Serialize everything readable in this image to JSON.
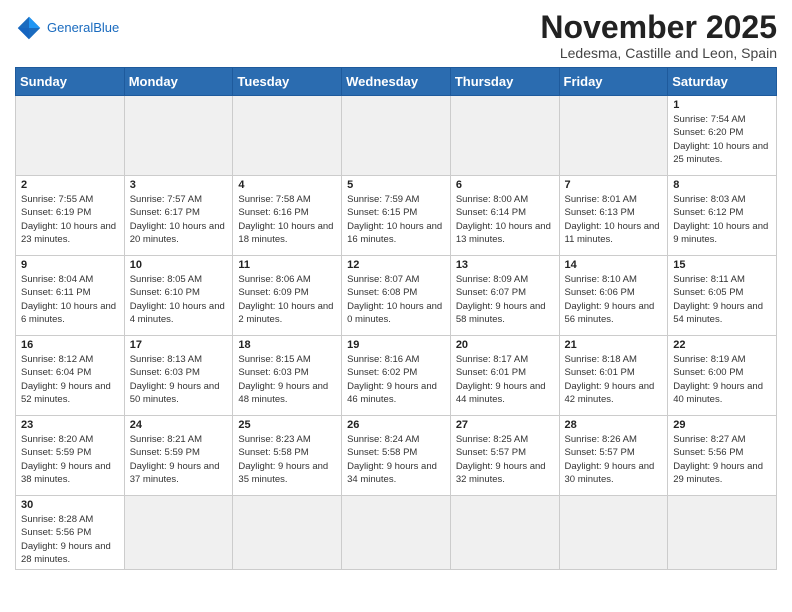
{
  "header": {
    "logo_general": "General",
    "logo_blue": "Blue",
    "month_title": "November 2025",
    "location": "Ledesma, Castille and Leon, Spain"
  },
  "weekdays": [
    "Sunday",
    "Monday",
    "Tuesday",
    "Wednesday",
    "Thursday",
    "Friday",
    "Saturday"
  ],
  "weeks": [
    [
      {
        "day": "",
        "info": ""
      },
      {
        "day": "",
        "info": ""
      },
      {
        "day": "",
        "info": ""
      },
      {
        "day": "",
        "info": ""
      },
      {
        "day": "",
        "info": ""
      },
      {
        "day": "",
        "info": ""
      },
      {
        "day": "1",
        "info": "Sunrise: 7:54 AM\nSunset: 6:20 PM\nDaylight: 10 hours and 25 minutes."
      }
    ],
    [
      {
        "day": "2",
        "info": "Sunrise: 7:55 AM\nSunset: 6:19 PM\nDaylight: 10 hours and 23 minutes."
      },
      {
        "day": "3",
        "info": "Sunrise: 7:57 AM\nSunset: 6:17 PM\nDaylight: 10 hours and 20 minutes."
      },
      {
        "day": "4",
        "info": "Sunrise: 7:58 AM\nSunset: 6:16 PM\nDaylight: 10 hours and 18 minutes."
      },
      {
        "day": "5",
        "info": "Sunrise: 7:59 AM\nSunset: 6:15 PM\nDaylight: 10 hours and 16 minutes."
      },
      {
        "day": "6",
        "info": "Sunrise: 8:00 AM\nSunset: 6:14 PM\nDaylight: 10 hours and 13 minutes."
      },
      {
        "day": "7",
        "info": "Sunrise: 8:01 AM\nSunset: 6:13 PM\nDaylight: 10 hours and 11 minutes."
      },
      {
        "day": "8",
        "info": "Sunrise: 8:03 AM\nSunset: 6:12 PM\nDaylight: 10 hours and 9 minutes."
      }
    ],
    [
      {
        "day": "9",
        "info": "Sunrise: 8:04 AM\nSunset: 6:11 PM\nDaylight: 10 hours and 6 minutes."
      },
      {
        "day": "10",
        "info": "Sunrise: 8:05 AM\nSunset: 6:10 PM\nDaylight: 10 hours and 4 minutes."
      },
      {
        "day": "11",
        "info": "Sunrise: 8:06 AM\nSunset: 6:09 PM\nDaylight: 10 hours and 2 minutes."
      },
      {
        "day": "12",
        "info": "Sunrise: 8:07 AM\nSunset: 6:08 PM\nDaylight: 10 hours and 0 minutes."
      },
      {
        "day": "13",
        "info": "Sunrise: 8:09 AM\nSunset: 6:07 PM\nDaylight: 9 hours and 58 minutes."
      },
      {
        "day": "14",
        "info": "Sunrise: 8:10 AM\nSunset: 6:06 PM\nDaylight: 9 hours and 56 minutes."
      },
      {
        "day": "15",
        "info": "Sunrise: 8:11 AM\nSunset: 6:05 PM\nDaylight: 9 hours and 54 minutes."
      }
    ],
    [
      {
        "day": "16",
        "info": "Sunrise: 8:12 AM\nSunset: 6:04 PM\nDaylight: 9 hours and 52 minutes."
      },
      {
        "day": "17",
        "info": "Sunrise: 8:13 AM\nSunset: 6:03 PM\nDaylight: 9 hours and 50 minutes."
      },
      {
        "day": "18",
        "info": "Sunrise: 8:15 AM\nSunset: 6:03 PM\nDaylight: 9 hours and 48 minutes."
      },
      {
        "day": "19",
        "info": "Sunrise: 8:16 AM\nSunset: 6:02 PM\nDaylight: 9 hours and 46 minutes."
      },
      {
        "day": "20",
        "info": "Sunrise: 8:17 AM\nSunset: 6:01 PM\nDaylight: 9 hours and 44 minutes."
      },
      {
        "day": "21",
        "info": "Sunrise: 8:18 AM\nSunset: 6:01 PM\nDaylight: 9 hours and 42 minutes."
      },
      {
        "day": "22",
        "info": "Sunrise: 8:19 AM\nSunset: 6:00 PM\nDaylight: 9 hours and 40 minutes."
      }
    ],
    [
      {
        "day": "23",
        "info": "Sunrise: 8:20 AM\nSunset: 5:59 PM\nDaylight: 9 hours and 38 minutes."
      },
      {
        "day": "24",
        "info": "Sunrise: 8:21 AM\nSunset: 5:59 PM\nDaylight: 9 hours and 37 minutes."
      },
      {
        "day": "25",
        "info": "Sunrise: 8:23 AM\nSunset: 5:58 PM\nDaylight: 9 hours and 35 minutes."
      },
      {
        "day": "26",
        "info": "Sunrise: 8:24 AM\nSunset: 5:58 PM\nDaylight: 9 hours and 34 minutes."
      },
      {
        "day": "27",
        "info": "Sunrise: 8:25 AM\nSunset: 5:57 PM\nDaylight: 9 hours and 32 minutes."
      },
      {
        "day": "28",
        "info": "Sunrise: 8:26 AM\nSunset: 5:57 PM\nDaylight: 9 hours and 30 minutes."
      },
      {
        "day": "29",
        "info": "Sunrise: 8:27 AM\nSunset: 5:56 PM\nDaylight: 9 hours and 29 minutes."
      }
    ],
    [
      {
        "day": "30",
        "info": "Sunrise: 8:28 AM\nSunset: 5:56 PM\nDaylight: 9 hours and 28 minutes."
      },
      {
        "day": "",
        "info": ""
      },
      {
        "day": "",
        "info": ""
      },
      {
        "day": "",
        "info": ""
      },
      {
        "day": "",
        "info": ""
      },
      {
        "day": "",
        "info": ""
      },
      {
        "day": "",
        "info": ""
      }
    ]
  ]
}
